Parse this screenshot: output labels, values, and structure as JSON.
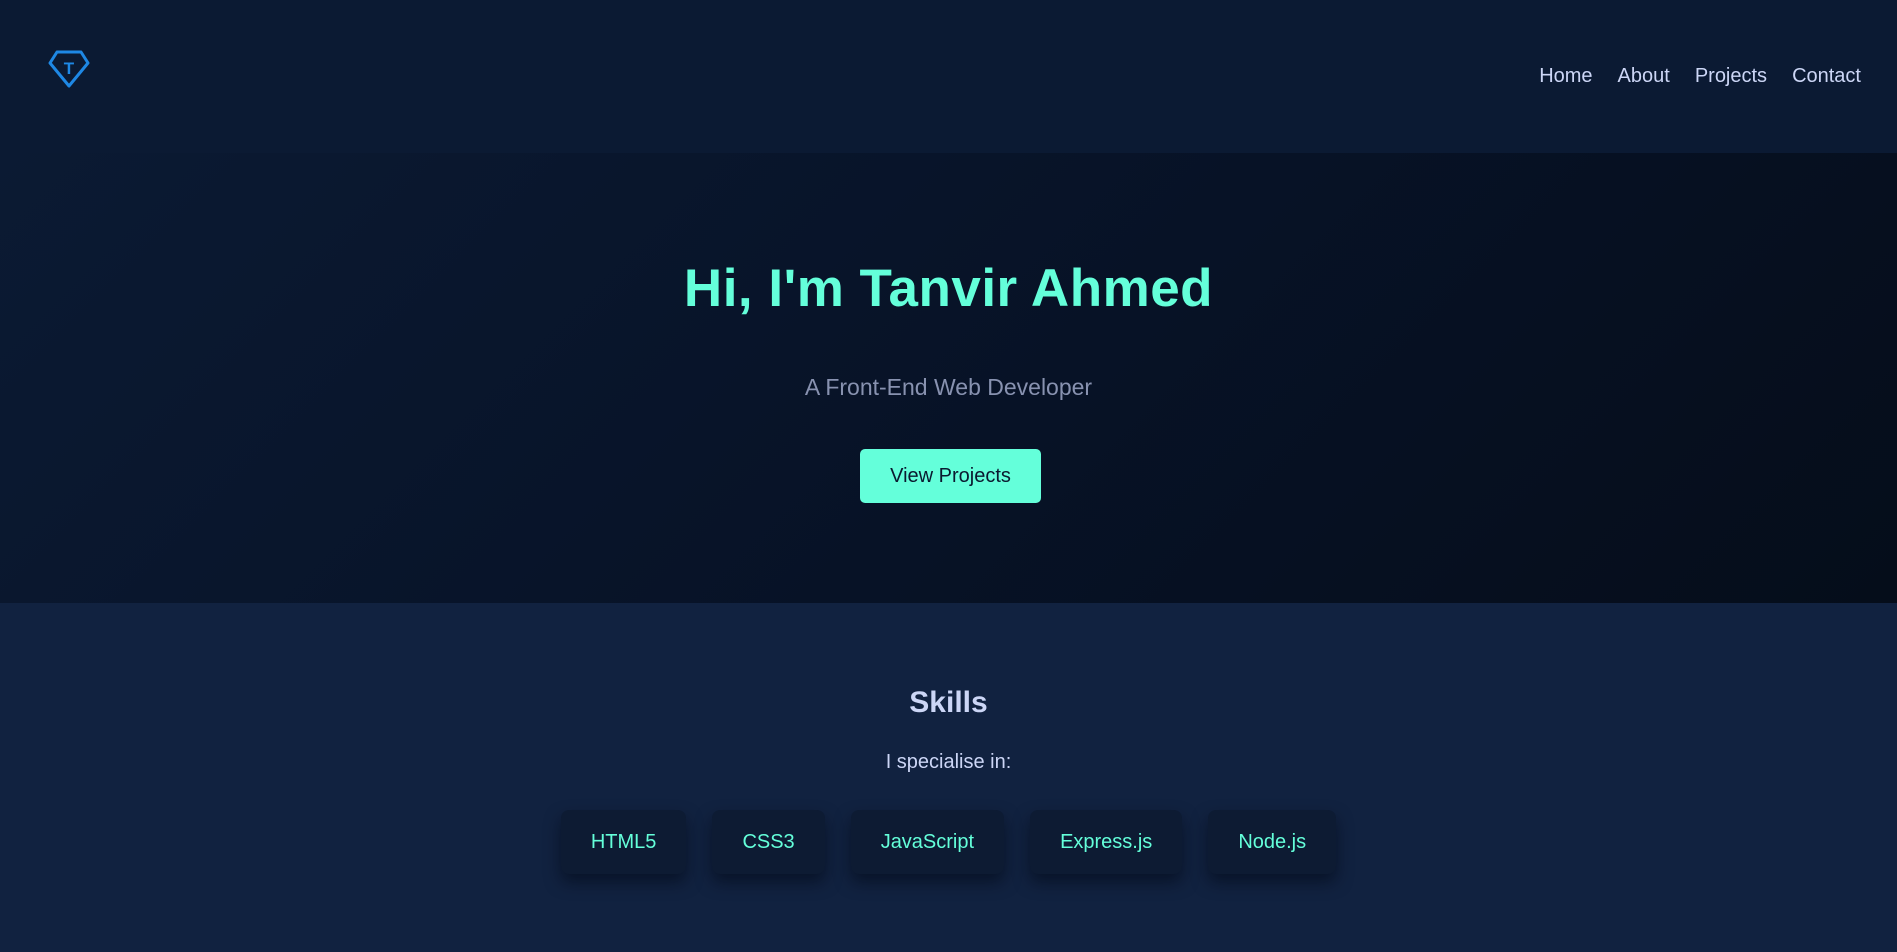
{
  "header": {
    "logo_icon": "diamond-t-logo-icon",
    "logo_letter": "T",
    "nav": [
      {
        "label": "Home"
      },
      {
        "label": "About"
      },
      {
        "label": "Projects"
      },
      {
        "label": "Contact"
      }
    ]
  },
  "hero": {
    "title": "Hi, I'm Tanvir Ahmed",
    "subtitle": "A Front-End Web Developer",
    "cta_label": "View Projects"
  },
  "skills": {
    "title": "Skills",
    "intro": "I specialise in:",
    "items": [
      "HTML5",
      "CSS3",
      "JavaScript",
      "Express.js",
      "Node.js"
    ]
  },
  "colors": {
    "accent": "#64ffda",
    "background": "#0a192f",
    "section_background": "#112240",
    "text_light": "#ccd6f6",
    "text_muted": "#8892b0",
    "logo_blue": "#1e88e5"
  }
}
